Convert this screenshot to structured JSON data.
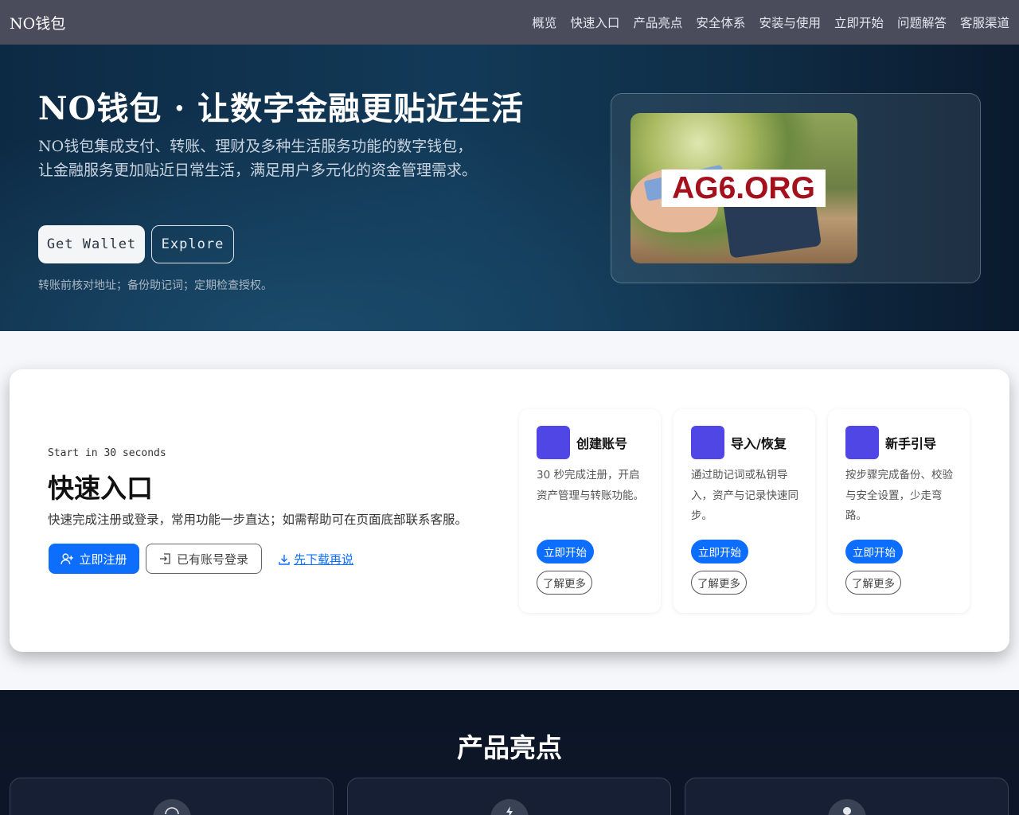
{
  "nav": {
    "brand": "NO钱包",
    "links": [
      "概览",
      "快速入口",
      "产品亮点",
      "安全体系",
      "安装与使用",
      "立即开始",
      "问题解答",
      "客服渠道"
    ]
  },
  "hero": {
    "title": "NO钱包 · 让数字金融更贴近生活",
    "description": "NO钱包集成支付、转账、理财及多种生活服务功能的数字钱包，让金融服务更加贴近日常生活，满足用户多元化的资金管理需求。",
    "primary_button": "Get Wallet",
    "secondary_button": "Explore",
    "tip": "转账前核对地址；备份助记词；定期检查授权。",
    "image_overlay": "AG6.ORG"
  },
  "quick": {
    "eyebrow": "Start in 30 seconds",
    "title": "快速入口",
    "description": "快速完成注册或登录，常用功能一步直达；如需帮助可在页面底部联系客服。",
    "register_button": "立即注册",
    "login_button": "已有账号登录",
    "download_link": "先下载再说",
    "cards": [
      {
        "title": "创建账号",
        "desc": "30 秒完成注册，开启资产管理与转账功能。",
        "primary": "立即开始",
        "secondary": "了解更多"
      },
      {
        "title": "导入/恢复",
        "desc": "通过助记词或私钥导入，资产与记录快速同步。",
        "primary": "立即开始",
        "secondary": "了解更多"
      },
      {
        "title": "新手引导",
        "desc": "按步骤完成备份、校验与安全设置，少走弯路。",
        "primary": "立即开始",
        "secondary": "了解更多"
      }
    ]
  },
  "highlights": {
    "title": "产品亮点"
  },
  "colors": {
    "accent": "#0d6efd",
    "icon_square": "#4f46e5",
    "nav_bg": "#4a4c5b"
  }
}
